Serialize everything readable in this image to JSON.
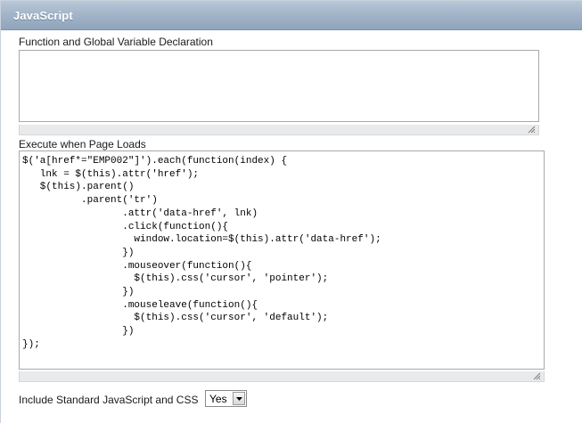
{
  "region": {
    "title": "JavaScript"
  },
  "function_declaration": {
    "label": "Function and Global Variable Declaration",
    "value": ""
  },
  "page_load": {
    "label": "Execute when Page Loads",
    "code": "$('a[href*=\"EMP002\"]').each(function(index) {\n   lnk = $(this).attr('href');\n   $(this).parent()\n          .parent('tr')\n                 .attr('data-href', lnk)\n                 .click(function(){\n                   window.location=$(this).attr('data-href');\n                 })\n                 .mouseover(function(){\n                   $(this).css('cursor', 'pointer');\n                 })\n                 .mouseleave(function(){\n                   $(this).css('cursor', 'default');\n                 })\n});"
  },
  "include_standard": {
    "label": "Include Standard JavaScript and CSS",
    "selected": "Yes"
  },
  "icons": {
    "resize_grip": "resize-grip-icon",
    "dropdown_arrow": "chevron-down-icon"
  },
  "colors": {
    "header_gradient_top": "#b9c8d8",
    "header_gradient_bottom": "#8fa4bb",
    "header_text": "#ffffff"
  }
}
